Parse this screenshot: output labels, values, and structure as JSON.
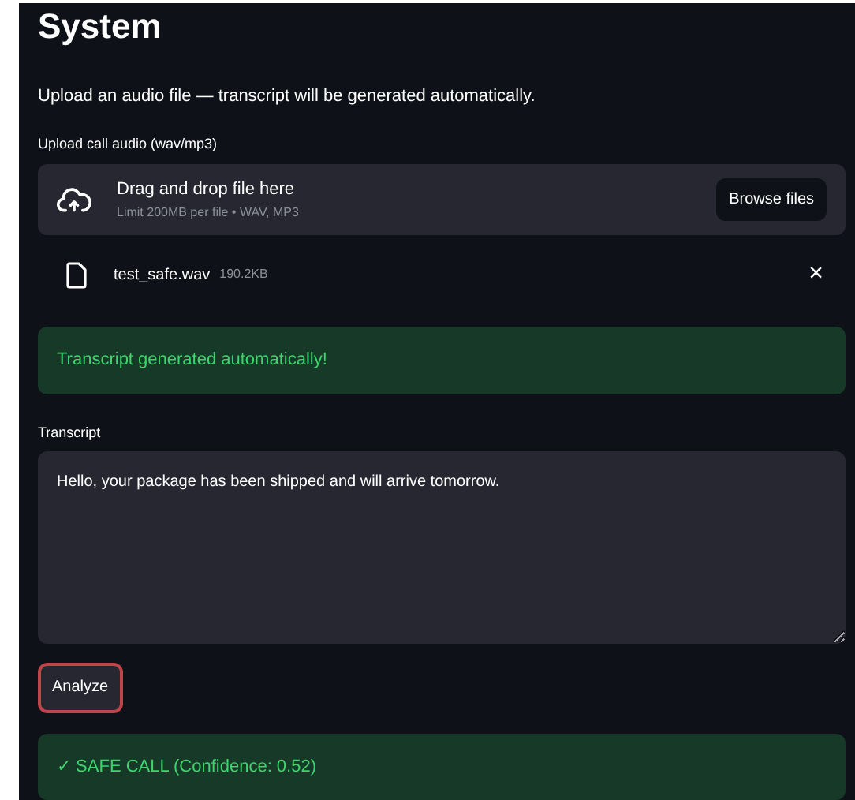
{
  "heading": "System",
  "intro": "Upload an audio file — transcript will be generated automatically.",
  "uploader": {
    "label": "Upload call audio (wav/mp3)",
    "title": "Drag and drop file here",
    "hint": "Limit 200MB per file • WAV, MP3",
    "button": "Browse files"
  },
  "files": [
    {
      "name": "test_safe.wav",
      "size": "190.2KB",
      "remove": "×"
    }
  ],
  "notice": {
    "kind": "success",
    "text": "Transcript generated automatically!"
  },
  "transcript": {
    "label": "Transcript",
    "value": "Hello, your package has been shipped and will arrive tomorrow."
  },
  "analyze": {
    "label": "Analyze",
    "focused": true
  },
  "result": {
    "kind": "success",
    "text": "✓ SAFE CALL (Confidence: 0.52)"
  }
}
